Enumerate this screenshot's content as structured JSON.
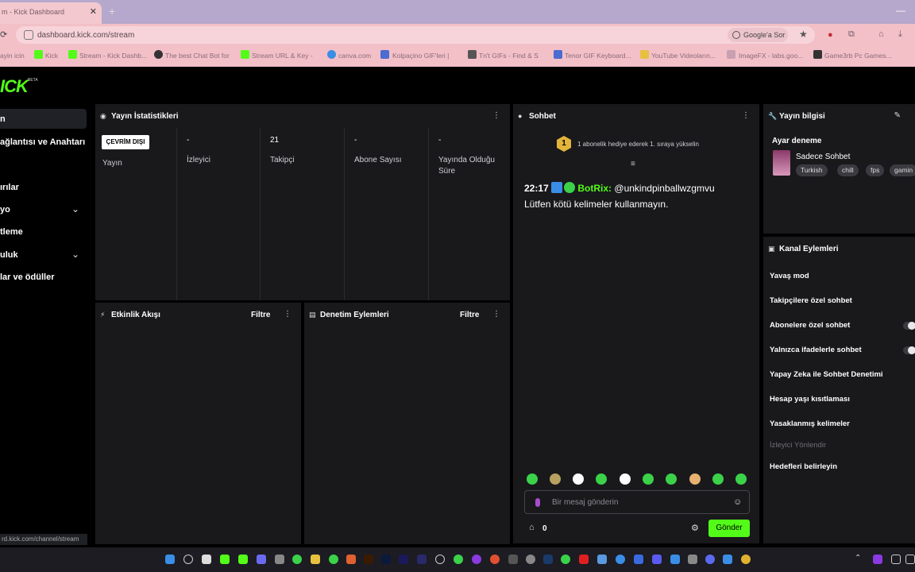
{
  "browser": {
    "tab_title": "m - Kick Dashboard",
    "tab_close": "✕",
    "new_tab": "+",
    "url": "dashboard.kick.com/stream",
    "google_search": "Google'a Sor",
    "bookmarks": [
      "ayin icin",
      "Kick",
      "Stream - Kick Dashb...",
      "The best Chat Bot for",
      "Stream URL & Key -",
      "canva.com",
      "Kolpaçino GIF'leri |",
      "Tn't GIFs - Find & S",
      "Tenor GIF Keyboard...",
      "YouTube Videoların...",
      "ImageFX - labs.goo...",
      "Game3rb Pc Games..."
    ],
    "status_url": "rd.kick.com/channel/stream"
  },
  "logo": {
    "text": "ICK",
    "beta": "BETA"
  },
  "sidebar": {
    "items": [
      {
        "label": "n"
      },
      {
        "label": "ağlantısı ve Anahtarı"
      },
      {
        "label": "ırılar"
      },
      {
        "label": "yo"
      },
      {
        "label": "tleme"
      },
      {
        "label": "uluk"
      },
      {
        "label": "lar ve ödüller"
      }
    ]
  },
  "stats": {
    "title": "Yayın İstatistikleri",
    "offline_badge": "ÇEVRİM DIŞI",
    "columns": [
      {
        "value": "",
        "label": "Yayın"
      },
      {
        "value": "-",
        "label": "İzleyici"
      },
      {
        "value": "21",
        "label": "Takipçi"
      },
      {
        "value": "-",
        "label": "Abone Sayısı"
      },
      {
        "value": "-",
        "label": "Yayında Olduğu Süre"
      }
    ]
  },
  "activity": {
    "title": "Etkinlik Akışı",
    "filter": "Filtre"
  },
  "moderation": {
    "title": "Denetim Eylemleri",
    "filter": "Filtre"
  },
  "chat": {
    "title": "Sohbet",
    "gift_count": "1",
    "gift_text": "1 abonelik hediye ederek 1. sıraya yükselin",
    "message": {
      "time": "22:17",
      "user": "BotRix:",
      "mention": "@unkindpinballwzgmvu",
      "text": "Lütfen kötü kelimeler kullanmayın."
    },
    "input_placeholder": "Bir mesaj gönderin",
    "send": "Gönder",
    "points": "0",
    "emote_colors": [
      "#3bd24a",
      "#b8a060",
      "#ffffff",
      "#3bd24a",
      "#ffffff",
      "#3bd24a",
      "#3bd24a",
      "#e8b070",
      "#3bd24a",
      "#3bd24a"
    ]
  },
  "stream_info": {
    "title": "Yayın bilgisi",
    "section_label": "Ayar deneme",
    "category": "Sadece Sohbet",
    "tags": [
      "Turkish",
      "chill",
      "fps",
      "gamin"
    ]
  },
  "channel_actions": {
    "title": "Kanal Eylemleri",
    "items": [
      {
        "label": "Yavaş mod"
      },
      {
        "label": "Takipçilere özel sohbet"
      },
      {
        "label": "Abonelere özel sohbet"
      },
      {
        "label": "Yalnızca ifadelerle sohbet"
      },
      {
        "label": "Yapay Zeka ile Sohbet Denetimi"
      },
      {
        "label": "Hesap yaşı kısıtlaması"
      },
      {
        "label": "Yasaklanmış kelimeler"
      },
      {
        "label": "İzleyici Yönlendir"
      },
      {
        "label": "Hedefleri belirleyin"
      }
    ]
  },
  "colors": {
    "accent": "#53fc18",
    "panel": "#19191c"
  }
}
